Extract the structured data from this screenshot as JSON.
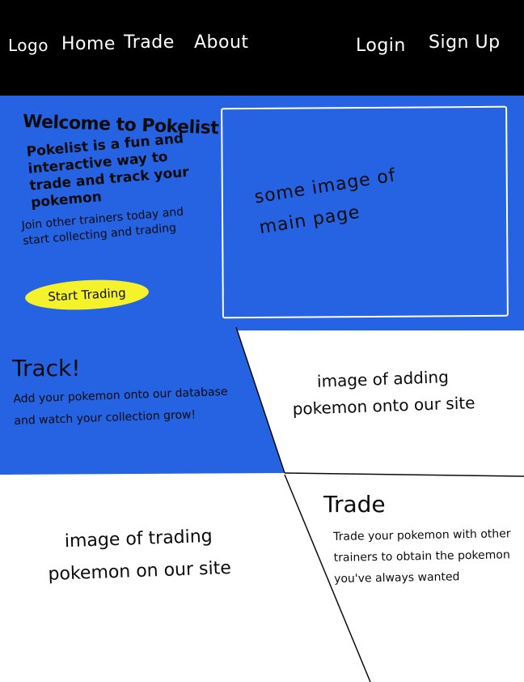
{
  "nav": {
    "logo": "Logo",
    "home": "Home",
    "trade": "Trade",
    "about": "About",
    "login": "Login",
    "signup": "Sign Up"
  },
  "hero": {
    "title": "Welcome to Pokelist",
    "lead": "Pokelist is a fun and interactive way to trade and track your pokemon",
    "sub": "Join other trainers today and start collecting and trading",
    "cta": "Start Trading",
    "image_label": "some image of main page"
  },
  "track": {
    "title": "Track!",
    "body": "Add your pokemon onto our database and watch your collection grow!",
    "image_label": "image of adding pokemon onto our site"
  },
  "trade": {
    "title": "Trade",
    "body": "Trade your pokemon with other trainers to obtain the pokemon you've always wanted",
    "image_label": "image of trading pokemon on our site"
  },
  "colors": {
    "nav_bg": "#000000",
    "hero_bg": "#2563e3",
    "cta_bg": "#f4f22a",
    "content_bg": "#ffffff"
  }
}
